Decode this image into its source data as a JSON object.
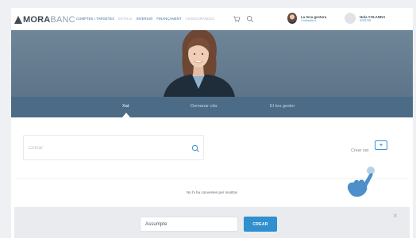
{
  "app": {
    "logo_bold": "MORA",
    "logo_light": "BANC"
  },
  "nav": {
    "items": [
      {
        "label": "COMPTES I TARGETES",
        "state": "active"
      },
      {
        "label": "ESTALVI",
        "state": "muted"
      },
      {
        "label": "INVERSIÓ",
        "state": "active"
      },
      {
        "label": "FINANÇAMENT",
        "state": "active"
      },
      {
        "label": "ASSEGURANCES",
        "state": "muted"
      }
    ],
    "cart_icon": "cart-icon",
    "search_icon": "search-icon"
  },
  "gestor": {
    "title": "La teva gestora",
    "subtitle": "Contactla A"
  },
  "user": {
    "title": "Hola YOLANDA",
    "subtitle": "SORTIR"
  },
  "tabs": [
    {
      "label": "Xat",
      "active": true
    },
    {
      "label": "Demanar cita",
      "active": false
    },
    {
      "label": "El teu gestor",
      "active": false
    }
  ],
  "search": {
    "placeholder": "Cercar",
    "icon": "search-icon"
  },
  "create_chat": {
    "label": "Crear xat",
    "icon": "new-chat-icon"
  },
  "empty_message": "No hi ha converses per mostrar",
  "compose": {
    "subject_placeholder": "Assumpte",
    "create_label": "CREAR",
    "close_label": "×"
  },
  "colors": {
    "accent": "#2f8fcf",
    "tabbar": "#4c6b86",
    "hero": "#6f8598",
    "hand": "#4d8fc8"
  }
}
